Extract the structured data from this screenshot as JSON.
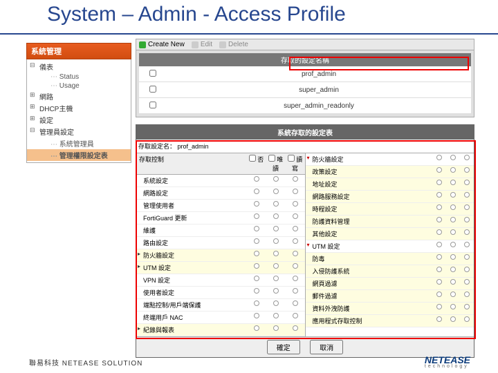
{
  "slide": {
    "title": "System – Admin - Access Profile"
  },
  "nav": {
    "header": "系統管理",
    "items": [
      {
        "label": "儀表",
        "lvl": 1,
        "exp": "−"
      },
      {
        "label": "Status",
        "lvl": 2,
        "dots": true
      },
      {
        "label": "Usage",
        "lvl": 2,
        "dots": true
      },
      {
        "label": "網路",
        "lvl": 1,
        "exp": "+"
      },
      {
        "label": "DHCP主機",
        "lvl": 1,
        "exp": "+"
      },
      {
        "label": "設定",
        "lvl": 1,
        "exp": "+"
      },
      {
        "label": "管理員設定",
        "lvl": 1,
        "exp": "−"
      },
      {
        "label": "系統管理員",
        "lvl": 2,
        "dots": true
      },
      {
        "label": "管理權限設定表",
        "lvl": 2,
        "dots": true,
        "selected": true
      }
    ]
  },
  "toolbar": {
    "create": "Create New",
    "edit": "Edit",
    "del": "Delete"
  },
  "profileList": {
    "header": "存取的設定名稱",
    "rows": [
      "prof_admin",
      "super_admin",
      "super_admin_readonly"
    ]
  },
  "editor": {
    "title": "系統存取的設定表",
    "nameLabel": "存取設定名：",
    "nameValue": "prof_admin",
    "colHeader": "存取控制",
    "radios": [
      "否",
      "唯讀",
      "讀寫"
    ],
    "left": [
      {
        "label": "系統設定",
        "alt": false
      },
      {
        "label": "網路設定",
        "alt": false
      },
      {
        "label": "管理使用者",
        "alt": false
      },
      {
        "label": "FortiGuard 更新",
        "alt": false
      },
      {
        "label": "維護",
        "alt": false
      },
      {
        "label": "路由設定",
        "alt": false
      },
      {
        "label": "防火牆設定",
        "alt": true,
        "grp": true
      },
      {
        "label": "UTM 設定",
        "alt": true,
        "grp": true
      },
      {
        "label": "VPN 設定",
        "alt": false
      },
      {
        "label": "使用者設定",
        "alt": false
      },
      {
        "label": "端點控制/用戶端保護",
        "alt": false
      },
      {
        "label": "終端用戶 NAC",
        "alt": false
      },
      {
        "label": "紀錄與報表",
        "alt": true,
        "grp": true
      }
    ],
    "rightTop": {
      "label": "防火牆設定",
      "grp": true,
      "open": true
    },
    "rightTopItems": [
      {
        "label": "政策設定",
        "alt": true
      },
      {
        "label": "地址設定",
        "alt": true
      },
      {
        "label": "網路服務設定",
        "alt": true
      },
      {
        "label": "時程設定",
        "alt": true
      },
      {
        "label": "防護資料管理",
        "alt": true
      },
      {
        "label": "其他設定",
        "alt": true
      }
    ],
    "rightBot": {
      "label": "UTM 設定",
      "grp": true,
      "open": true
    },
    "rightBotItems": [
      {
        "label": "防毒",
        "alt": true
      },
      {
        "label": "入侵防護系統",
        "alt": true
      },
      {
        "label": "網頁過濾",
        "alt": true
      },
      {
        "label": "郵件過濾",
        "alt": true
      },
      {
        "label": "資料外洩防護",
        "alt": true
      },
      {
        "label": "應用程式存取控制",
        "alt": true
      }
    ],
    "ok": "確定",
    "cancel": "取消"
  },
  "footer": {
    "left": "聯易科技  NETEASE SOLUTION",
    "brand": "NETEASE",
    "brandSub": "technology"
  }
}
